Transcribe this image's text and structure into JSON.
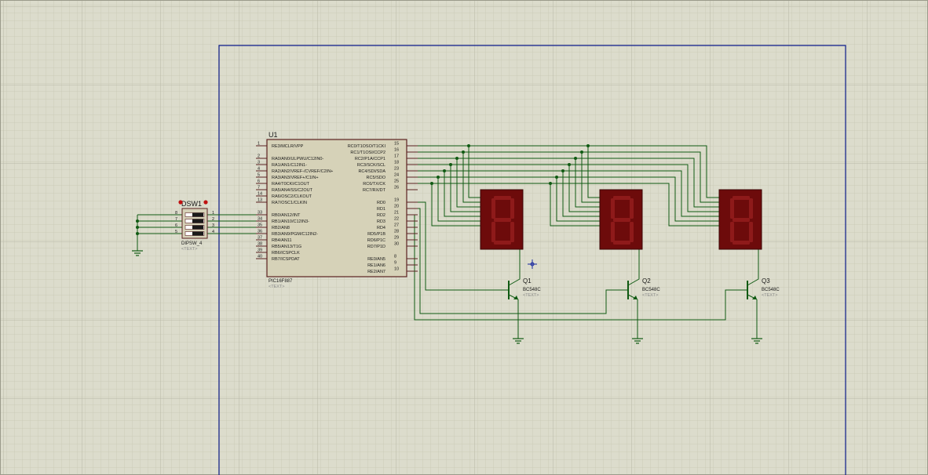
{
  "colors": {
    "background": "#dcdccc",
    "grid_minor": "#cfcfbd",
    "grid_major": "#bdbdab",
    "sheet_border": "#0b1a8a",
    "chip_fill": "#d6d2b8",
    "chip_stroke": "#5a2020",
    "wire": "#0f5a12",
    "pin": "#5a2020",
    "segment_body": "#6d0b0b",
    "segment_lit": "#8e1a1a",
    "text": "#1a1a1a",
    "text_faint": "#8a8a8a"
  },
  "mcu": {
    "ref": "U1",
    "part": "PIC16F887",
    "placeholder": "<TEXT>",
    "left_pins": [
      {
        "num": "1",
        "name": "RE3/MCLR/VPP"
      },
      {
        "num": "2",
        "name": "RA0/AN0/ULPWU/C12IN0-"
      },
      {
        "num": "3",
        "name": "RA1/AN1/C12IN1-"
      },
      {
        "num": "4",
        "name": "RA2/AN2/VREF-/CVREF/C2IN+"
      },
      {
        "num": "5",
        "name": "RA3/AN3/VREF+/C1IN+"
      },
      {
        "num": "6",
        "name": "RA4/T0CKI/C1OUT"
      },
      {
        "num": "7",
        "name": "RA5/AN4/SS/C2OUT"
      },
      {
        "num": "14",
        "name": "RA6/OSC2/CLKOUT"
      },
      {
        "num": "13",
        "name": "RA7/OSC1/CLKIN"
      },
      {
        "num": "33",
        "name": "RB0/AN12/INT"
      },
      {
        "num": "34",
        "name": "RB1/AN10/C12IN3-"
      },
      {
        "num": "35",
        "name": "RB2/AN8"
      },
      {
        "num": "36",
        "name": "RB3/AN9/PGM/C12IN2-"
      },
      {
        "num": "37",
        "name": "RB4/AN11"
      },
      {
        "num": "38",
        "name": "RB5/AN13/T1G"
      },
      {
        "num": "39",
        "name": "RB6/ICSPCLK"
      },
      {
        "num": "40",
        "name": "RB7/ICSPDAT"
      }
    ],
    "right_pins": [
      {
        "num": "15",
        "name": "RC0/T1OSO/T1CKI"
      },
      {
        "num": "16",
        "name": "RC1/T1OSI/CCP2"
      },
      {
        "num": "17",
        "name": "RC2/P1A/CCP1"
      },
      {
        "num": "18",
        "name": "RC3/SCK/SCL"
      },
      {
        "num": "23",
        "name": "RC4/SDI/SDA"
      },
      {
        "num": "24",
        "name": "RC5/SDO"
      },
      {
        "num": "25",
        "name": "RC6/TX/CK"
      },
      {
        "num": "26",
        "name": "RC7/RX/DT"
      },
      {
        "num": "19",
        "name": "RD0"
      },
      {
        "num": "20",
        "name": "RD1"
      },
      {
        "num": "21",
        "name": "RD2"
      },
      {
        "num": "22",
        "name": "RD3"
      },
      {
        "num": "27",
        "name": "RD4"
      },
      {
        "num": "28",
        "name": "RD5/P1B"
      },
      {
        "num": "29",
        "name": "RD6/P1C"
      },
      {
        "num": "30",
        "name": "RD7/P1D"
      },
      {
        "num": "8",
        "name": "RE0/AN5"
      },
      {
        "num": "9",
        "name": "RE1/AN6"
      },
      {
        "num": "10",
        "name": "RE2/AN7"
      }
    ]
  },
  "dipswitch": {
    "ref": "DSW1",
    "part": "DIPSW_4",
    "placeholder": "<TEXT>",
    "left_nums": [
      "8",
      "7",
      "6",
      "5"
    ],
    "right_nums": [
      "1",
      "2",
      "3",
      "4"
    ]
  },
  "transistors": [
    {
      "ref": "Q1",
      "part": "BC548C",
      "placeholder": "<TEXT>"
    },
    {
      "ref": "Q2",
      "part": "BC548C",
      "placeholder": "<TEXT>"
    },
    {
      "ref": "Q3",
      "part": "BC548C",
      "placeholder": "<TEXT>"
    }
  ],
  "displays": [
    {
      "digit": "8"
    },
    {
      "digit": "8"
    },
    {
      "digit": "8"
    }
  ]
}
